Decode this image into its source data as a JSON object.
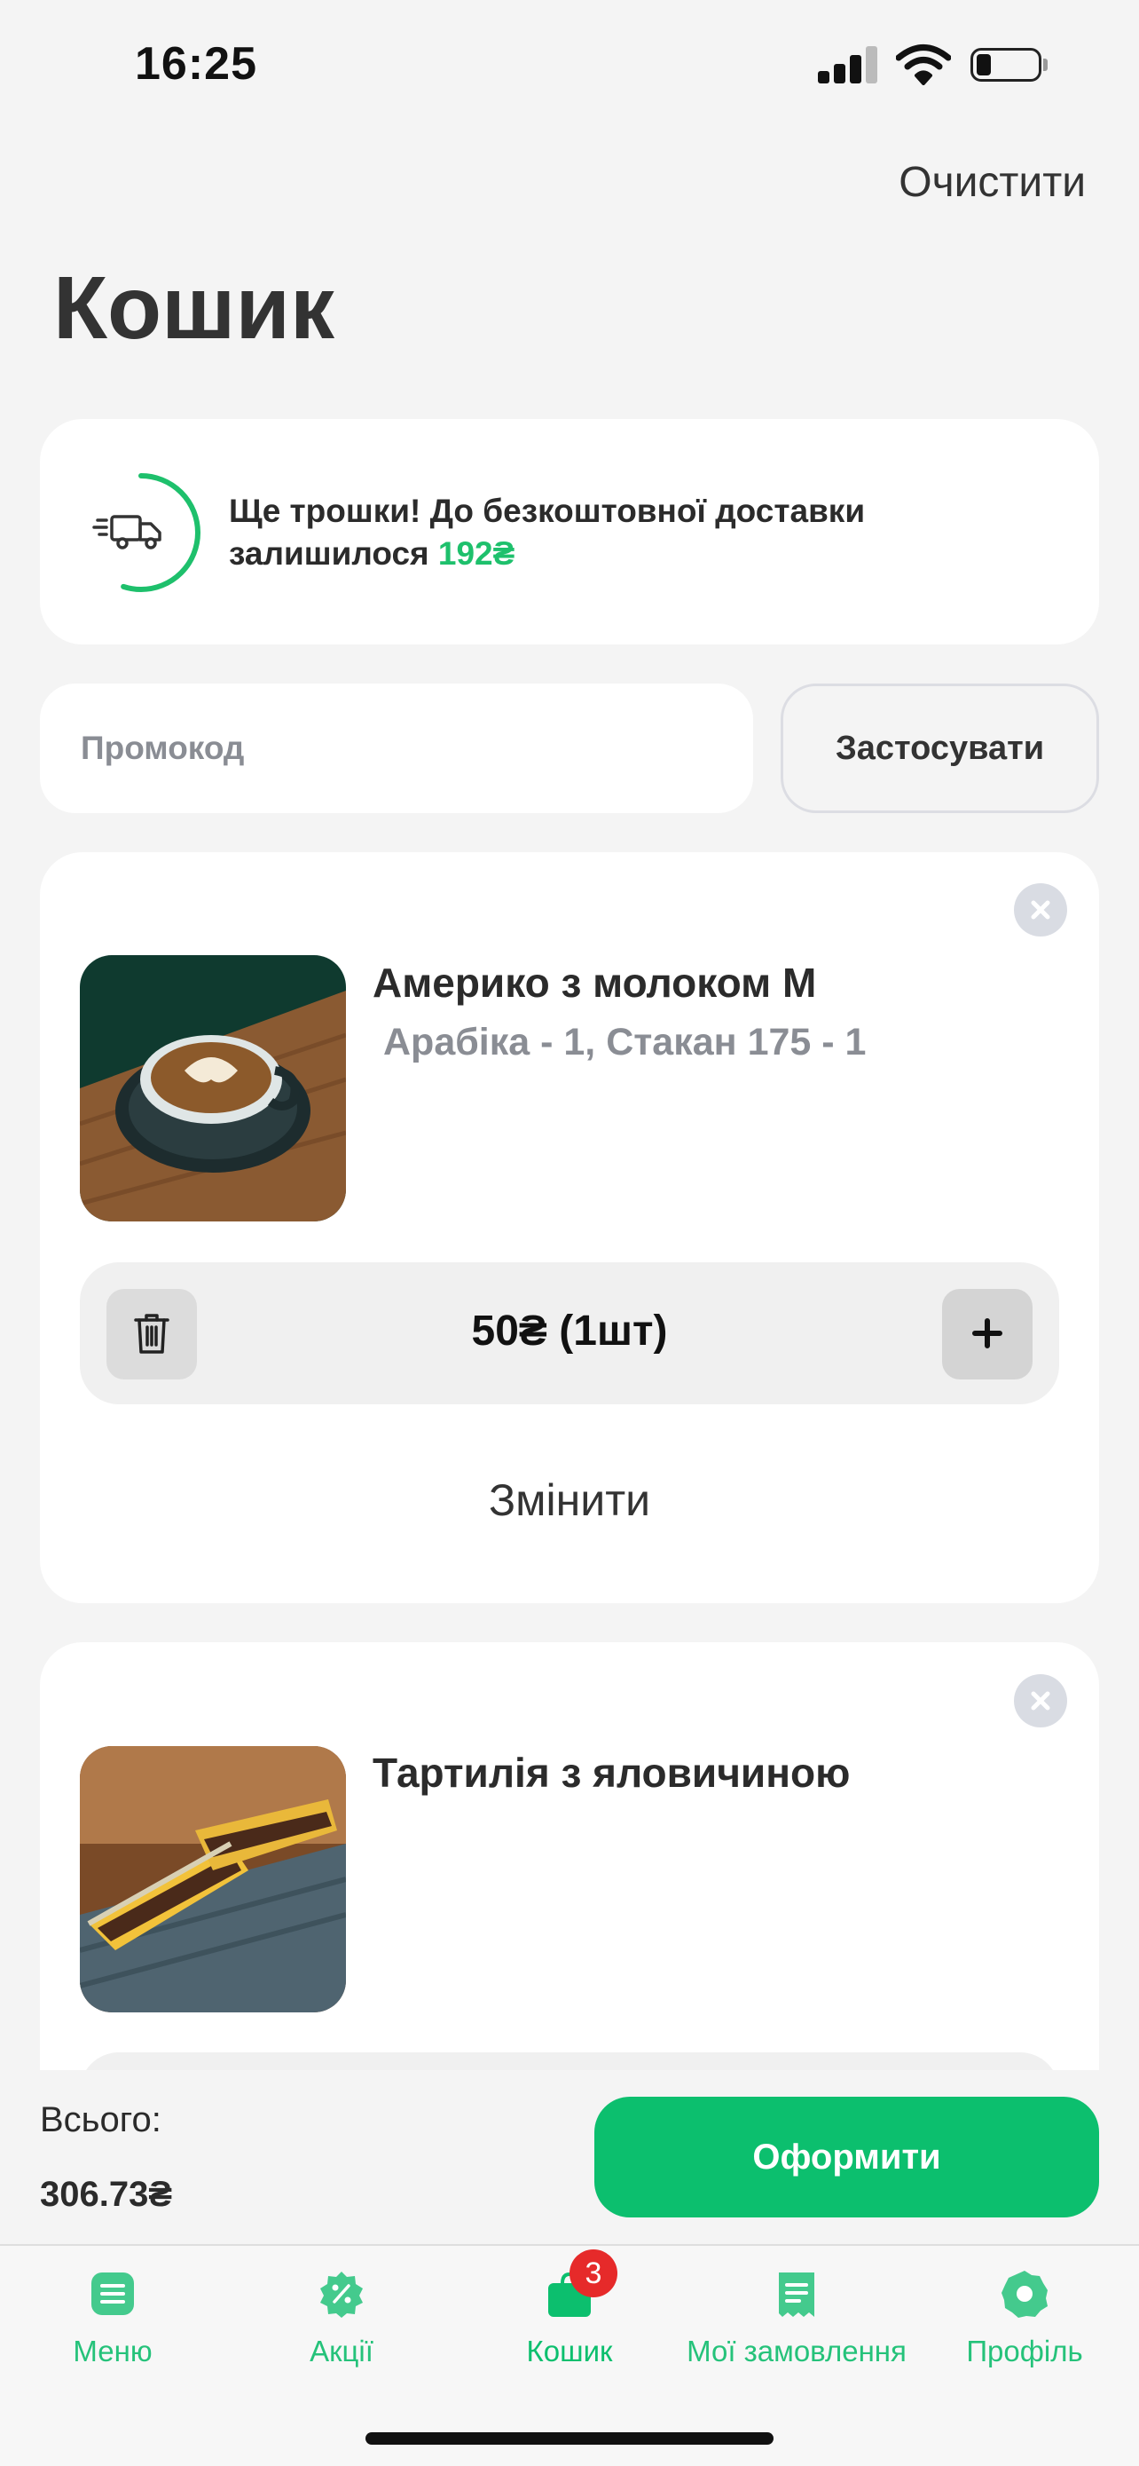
{
  "status_bar": {
    "time": "16:25"
  },
  "header": {
    "clear_label": "Очистити",
    "title": "Кошик"
  },
  "delivery": {
    "line1": "Ще трошки! До безкоштовної доставки",
    "line2_prefix": "залишилося",
    "remaining": "192₴",
    "progress_fraction": 0.55
  },
  "promo": {
    "placeholder": "Промокод",
    "apply_label": "Застосувати"
  },
  "items": [
    {
      "name": "Америко з молоком M",
      "options": "Арабіка - 1, Стакан 175 - 1",
      "price_qty": "50₴  (1шт)",
      "change_label": "Змінити"
    },
    {
      "name": "Тартилія з яловичиною"
    }
  ],
  "summary": {
    "total_label": "Всього:",
    "total_value": "306.73₴",
    "checkout_label": "Оформити"
  },
  "tabbar": {
    "tabs": [
      {
        "label": "Меню",
        "icon": "menu-icon"
      },
      {
        "label": "Акції",
        "icon": "percent-icon"
      },
      {
        "label": "Кошик",
        "icon": "bag-icon",
        "badge": "3"
      },
      {
        "label": "Мої замовлення",
        "icon": "receipt-icon"
      },
      {
        "label": "Профіль",
        "icon": "profile-icon"
      }
    ]
  },
  "colors": {
    "accent": "#0cbf6e",
    "tab_icon": "#25c27a",
    "badge": "#e62a2a"
  }
}
